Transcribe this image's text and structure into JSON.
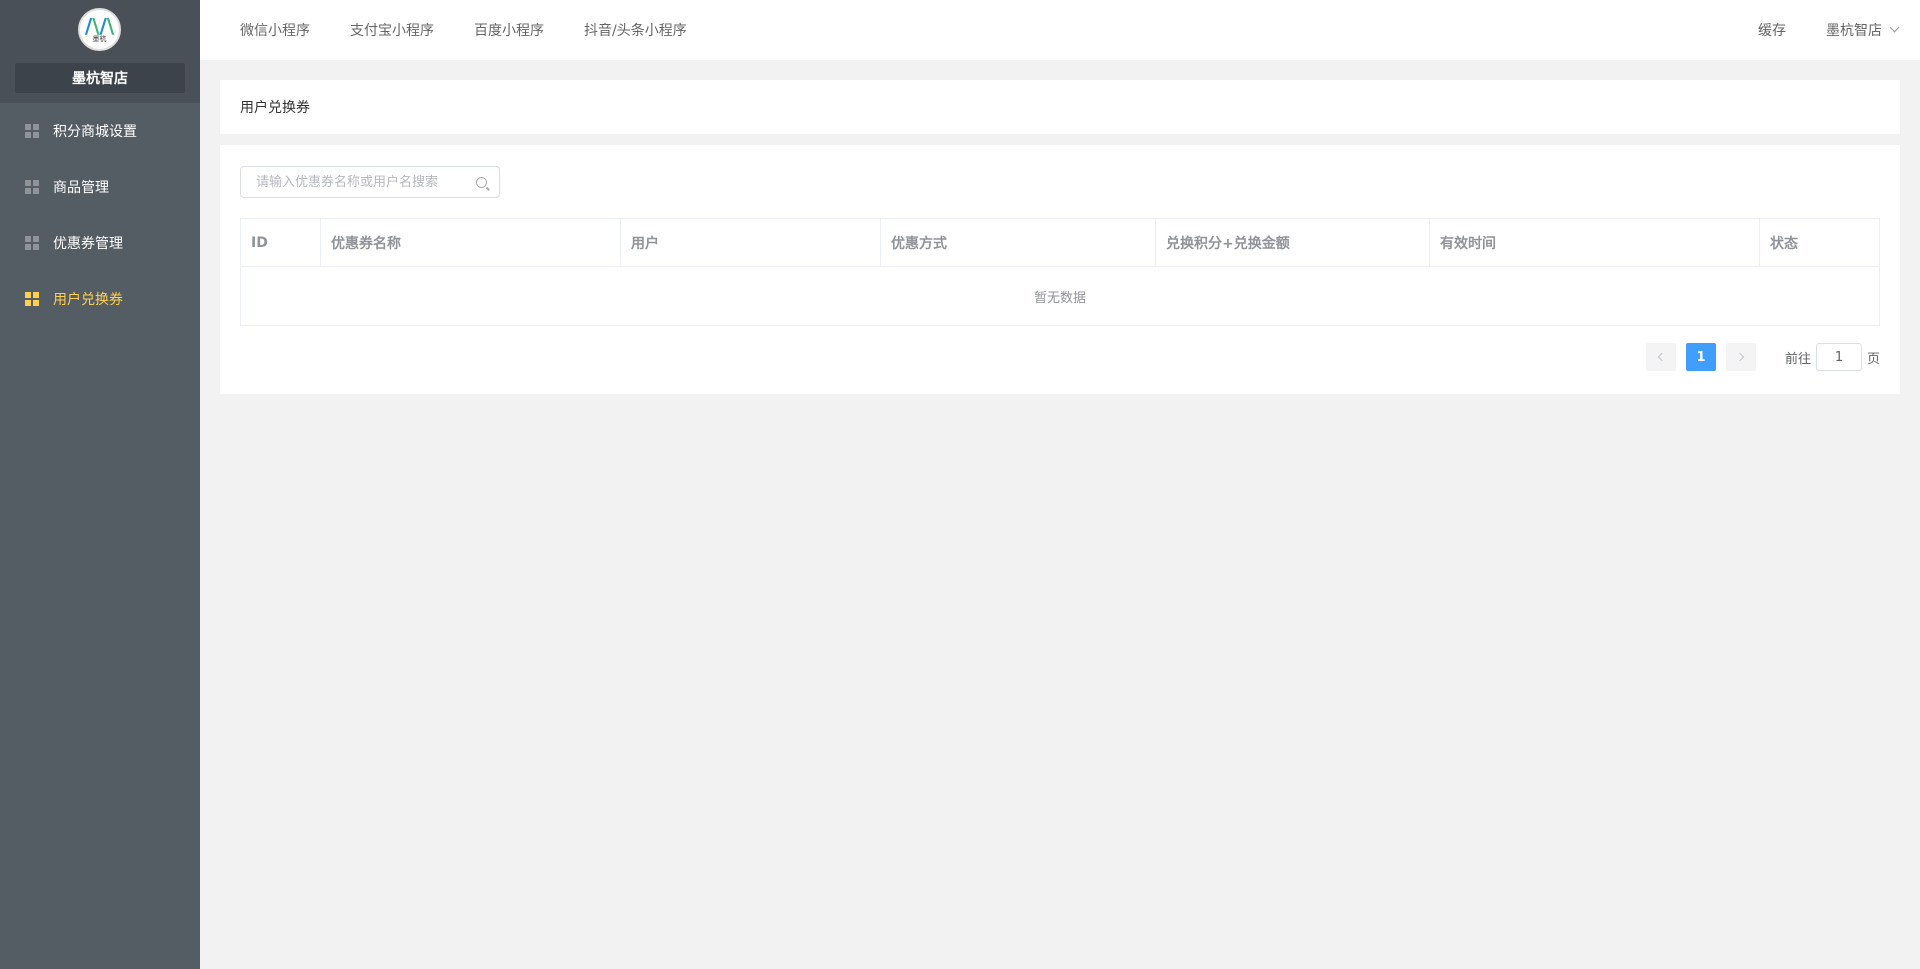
{
  "sidebar": {
    "logo_text": "墨杭",
    "store_name": "墨杭智店",
    "items": [
      {
        "label": "积分商城设置",
        "icon": "grid-icon",
        "active": false
      },
      {
        "label": "商品管理",
        "icon": "grid-icon",
        "active": false
      },
      {
        "label": "优惠券管理",
        "icon": "grid-icon",
        "active": false
      },
      {
        "label": "用户兑换券",
        "icon": "grid-icon",
        "active": true
      }
    ]
  },
  "topnav": {
    "items": [
      "微信小程序",
      "支付宝小程序",
      "百度小程序",
      "抖音/头条小程序"
    ],
    "cache": "缓存",
    "user": "墨杭智店"
  },
  "page": {
    "title": "用户兑换券"
  },
  "search": {
    "placeholder": "请输入优惠券名称或用户名搜索",
    "value": ""
  },
  "table": {
    "columns": [
      "ID",
      "优惠券名称",
      "用户",
      "优惠方式",
      "兑换积分+兑换金额",
      "有效时间",
      "状态"
    ],
    "rows": [],
    "empty_text": "暂无数据"
  },
  "pagination": {
    "current_page": "1",
    "goto_prefix": "前往",
    "goto_value": "1",
    "goto_suffix": "页"
  },
  "colors": {
    "sidebar_bg": "#545c64",
    "active_menu": "#ffd04b",
    "primary": "#409eff"
  }
}
